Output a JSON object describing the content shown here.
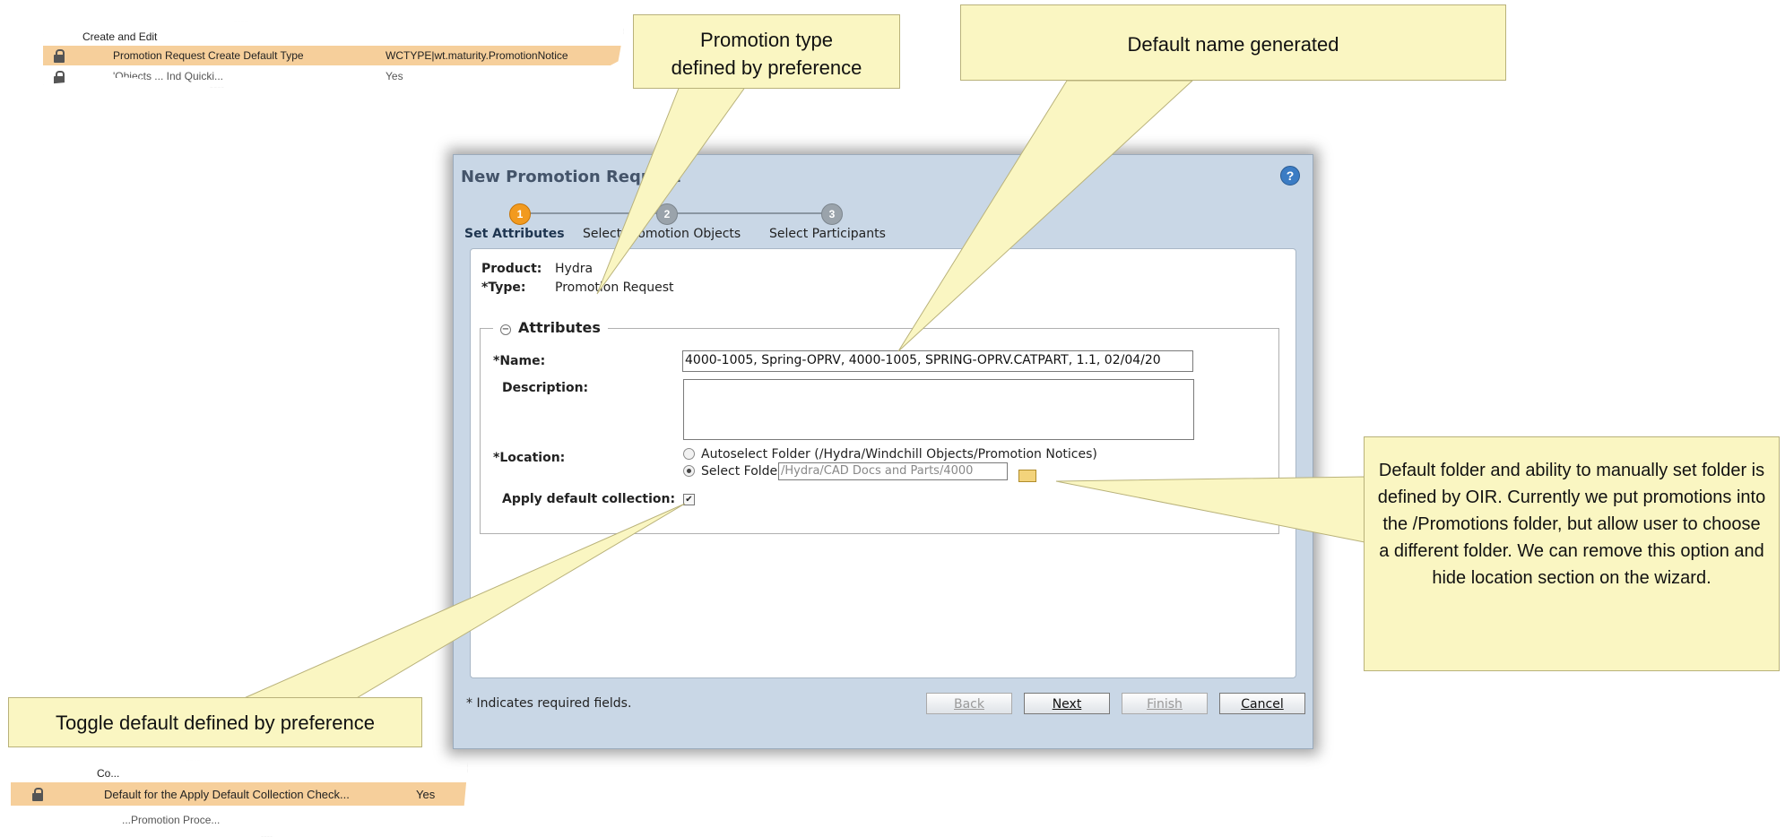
{
  "top_pref": {
    "group": "Create and Edit",
    "row1_name": "Promotion Request Create Default Type",
    "row1_value": "WCTYPE|wt.maturity.PromotionNotice",
    "row2_name": "'Objects ... Ind Quicki...",
    "row2_value": "Yes"
  },
  "bottom_pref": {
    "group": "Co...",
    "row1_name": "Default for the Apply Default Collection Check...",
    "row1_value": "Yes",
    "row2_name": "...Promotion Proce..."
  },
  "callouts": {
    "promotion_type": "Promotion type defined by preference",
    "default_name": "Default name generated",
    "folder": "Default folder and ability to manually set folder is defined by OIR. Currently we put promotions into the /Promotions folder, but allow user to choose a different folder. We can remove this option and hide location section on the wizard.",
    "toggle": "Toggle default defined by preference"
  },
  "dialog": {
    "title": "New Promotion Request",
    "help_icon": "question-circle",
    "steps": [
      {
        "number": "1",
        "label": "Set Attributes",
        "state": "active"
      },
      {
        "number": "2",
        "label": "Select Promotion Objects",
        "state": "inactive"
      },
      {
        "number": "3",
        "label": "Select Participants",
        "state": "inactive"
      }
    ],
    "product_label": "Product:",
    "product_value": "Hydra",
    "type_label": "*Type:",
    "type_value": "Promotion Request",
    "section_title": "Attributes",
    "name_label": "*Name:",
    "name_value": "4000-1005, Spring-OPRV, 4000-1005, SPRING-OPRV.CATPART, 1.1, 02/04/20",
    "description_label": "Description:",
    "description_value": "",
    "location_label": "*Location:",
    "autoselect_label": "Autoselect Folder (/Hydra/Windchill Objects/Promotion Notices)",
    "select_folder_label": "Select Folder",
    "select_folder_value": "/Hydra/CAD Docs and Parts/4000",
    "apply_collection_label": "Apply default collection:",
    "apply_collection_checked": "✔",
    "footnote": "* Indicates required fields.",
    "buttons": {
      "back": "Back",
      "next": "Next",
      "finish": "Finish",
      "cancel": "Cancel"
    }
  }
}
